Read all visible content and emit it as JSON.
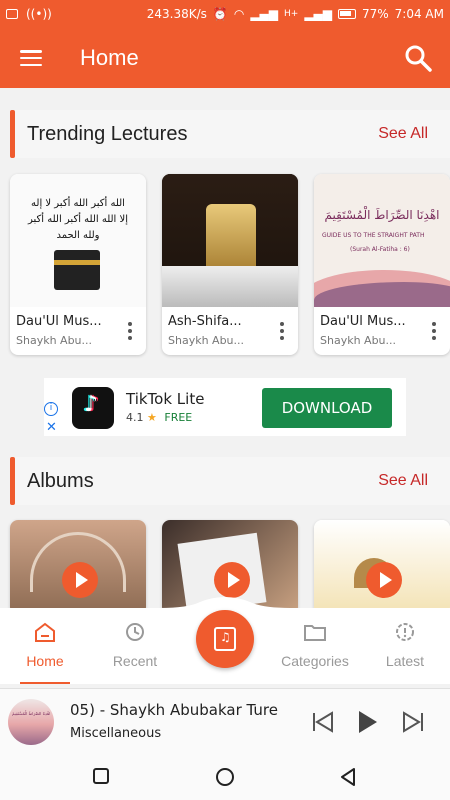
{
  "status_bar": {
    "network_speed": "243.38K/s",
    "carrier": "H+",
    "battery": "77%",
    "time": "7:04 AM"
  },
  "app_bar": {
    "title": "Home",
    "menu_icon": "hamburger-menu-icon",
    "search_icon": "search-icon"
  },
  "trending": {
    "title": "Trending Lectures",
    "see_all": "See All",
    "items": [
      {
        "title": "Dau'Ul Mus...",
        "subtitle": "Shaykh Abu...",
        "thumb_lines": [
          "الله أكبر الله أكبر لا إله",
          "إلا الله  الله أكبر الله أكبر",
          "ولله الحمد"
        ]
      },
      {
        "title": "Ash-Shifa...",
        "subtitle": "Shaykh Abu..."
      },
      {
        "title": "Dau'Ul Mus...",
        "subtitle": "Shaykh Abu...",
        "thumb_arabic": "اهْدِنَا الصِّرَاطَ الْمُسْتَقِيمَ",
        "thumb_english": "GUIDE US TO THE STRAIGHT PATH",
        "thumb_ref": "(Surah Al-Fatiha : 6)"
      }
    ]
  },
  "ad": {
    "app_name": "TikTok Lite",
    "rating": "4.1",
    "price": "FREE",
    "cta": "DOWNLOAD",
    "info_icon": "info-icon",
    "close_icon": "close-icon"
  },
  "albums": {
    "title": "Albums",
    "see_all": "See All"
  },
  "bottom_nav": {
    "items": [
      {
        "label": "Home",
        "icon": "home-icon",
        "active": true
      },
      {
        "label": "Recent",
        "icon": "history-icon",
        "active": false
      },
      {
        "label": "Categories",
        "icon": "folder-icon",
        "active": false
      },
      {
        "label": "Latest",
        "icon": "gear-badge-icon",
        "active": false
      }
    ],
    "fab_icon": "music-library-icon"
  },
  "player": {
    "title": "05) - Shaykh Abubakar Ture",
    "subtitle": "Miscellaneous"
  },
  "colors": {
    "accent": "#ef5b2e",
    "see_all": "#c62828",
    "download": "#1a8a4a"
  }
}
